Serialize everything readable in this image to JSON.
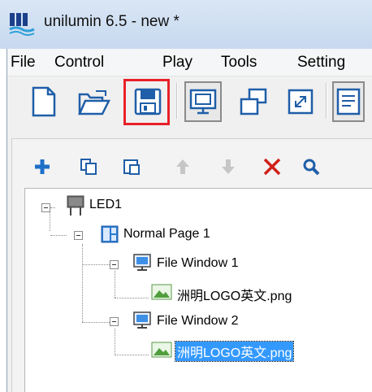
{
  "window": {
    "title": "unilumin 6.5 - new *"
  },
  "menu": [
    "File",
    "Control",
    "Play",
    "Tools",
    "Setting"
  ],
  "toolbar": {
    "buttons": [
      "new-file",
      "open-folder",
      "save",
      "screen",
      "window-cascade",
      "fullscreen",
      "text-window"
    ],
    "highlighted": "save",
    "highlight_color": "#e8202a"
  },
  "panel_tools": [
    "add",
    "copy",
    "paste",
    "move-up",
    "move-down",
    "delete",
    "search"
  ],
  "tree": {
    "led": "LED1",
    "page": "Normal Page 1",
    "window1": "File Window 1",
    "file1": "洲明LOGO英文.png",
    "window2": "File Window 2",
    "file2": "洲明LOGO英文.png"
  },
  "colors": {
    "selection": "#3399ff",
    "add": "#1e6fc7",
    "delete": "#d0201a"
  }
}
